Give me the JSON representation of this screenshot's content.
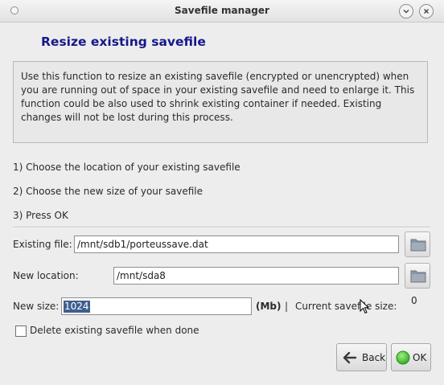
{
  "window": {
    "title": "Savefile manager"
  },
  "heading": "Resize existing savefile",
  "description": "Use this function to resize an existing savefile (encrypted or unencrypted) when you are running out of space in your existing savefile and need to enlarge it. This function could be also used to shrink existing container if needed. Existing changes will not be lost during this process.",
  "steps": [
    "1) Choose the location of your existing savefile",
    "2) Choose the new size of your savefile",
    "3) Press OK"
  ],
  "form": {
    "existing_file_label": "Existing file:",
    "existing_file_value": "/mnt/sdb1/porteussave.dat",
    "new_location_label": "New location:",
    "new_location_value": "/mnt/sda8",
    "new_size_label": "New size:",
    "new_size_value": "1024",
    "unit": "(Mb)",
    "pipe": "|",
    "current_size_label": "Current savefile size:",
    "current_size_value": "0",
    "delete_checkbox_label": "Delete existing savefile when done",
    "delete_checked": false
  },
  "buttons": {
    "back": "Back",
    "ok": "OK"
  },
  "colors": {
    "heading": "#15188a",
    "selection": "#3f5f8f",
    "ok_icon": "#3cbf2a"
  }
}
